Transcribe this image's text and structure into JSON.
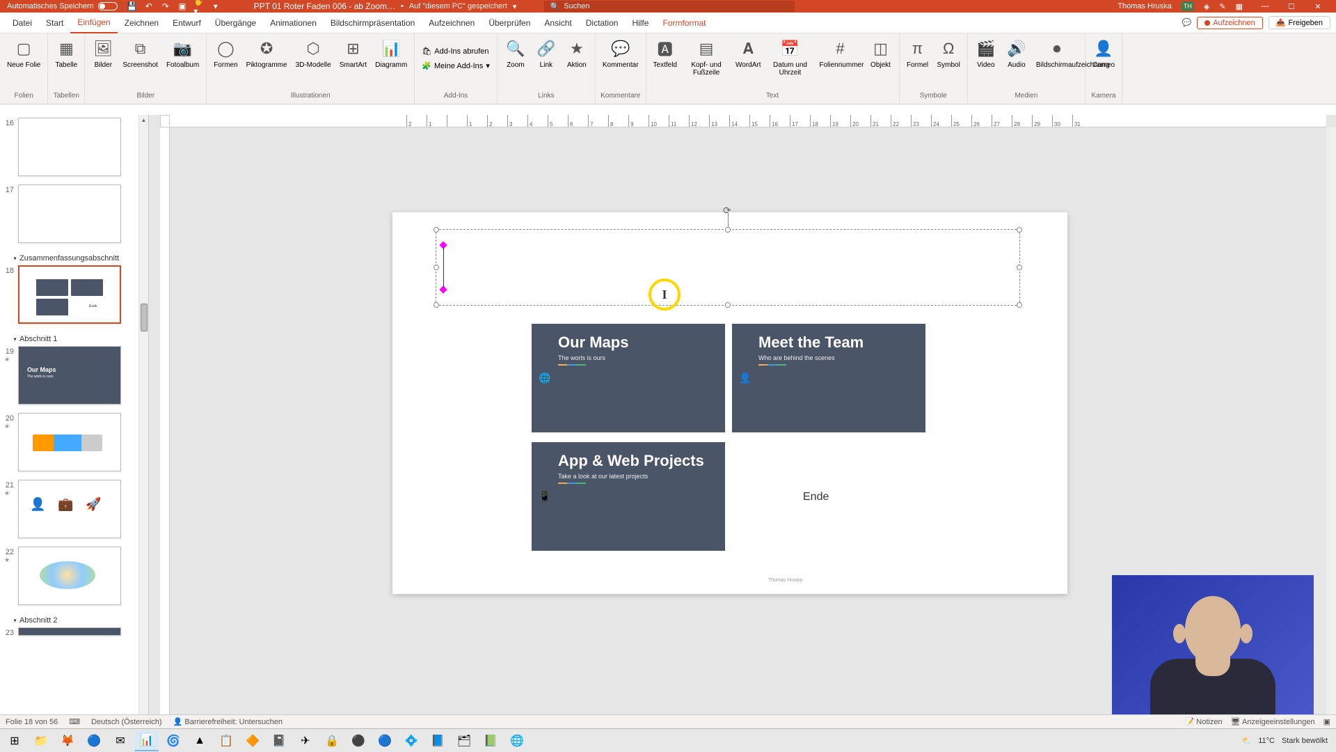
{
  "titlebar": {
    "autosave": "Automatisches Speichern",
    "filename": "PPT 01 Roter Faden 006 - ab Zoom…",
    "savedLoc": "Auf \"diesem PC\" gespeichert",
    "searchPlaceholder": "Suchen",
    "username": "Thomas Hruska",
    "initials": "TH"
  },
  "tabs": {
    "datei": "Datei",
    "start": "Start",
    "einfuegen": "Einfügen",
    "zeichnen": "Zeichnen",
    "entwurf": "Entwurf",
    "uebergaenge": "Übergänge",
    "animationen": "Animationen",
    "praesentation": "Bildschirmpräsentation",
    "aufzeichnen": "Aufzeichnen",
    "ueberpruefen": "Überprüfen",
    "ansicht": "Ansicht",
    "dictation": "Dictation",
    "hilfe": "Hilfe",
    "formformat": "Formformat",
    "aufzeichnenBtn": "Aufzeichnen",
    "freigeben": "Freigeben"
  },
  "ribbon": {
    "neueFolie": "Neue Folie",
    "tabelle": "Tabelle",
    "bilder": "Bilder",
    "screenshot": "Screenshot",
    "fotoalbum": "Fotoalbum",
    "formen": "Formen",
    "piktogramme": "Piktogramme",
    "d3": "3D-Modelle",
    "smartart": "SmartArt",
    "diagramm": "Diagramm",
    "addinsAbrufen": "Add-Ins abrufen",
    "meineAddins": "Meine Add-Ins",
    "zoom": "Zoom",
    "link": "Link",
    "aktion": "Aktion",
    "kommentar": "Kommentar",
    "textfeld": "Textfeld",
    "kopfFuss": "Kopf- und Fußzeile",
    "wordart": "WordArt",
    "datumUhrzeit": "Datum und Uhrzeit",
    "foliennummer": "Foliennummer",
    "objekt": "Objekt",
    "formel": "Formel",
    "symbol": "Symbol",
    "video": "Video",
    "audio": "Audio",
    "bildschirmaufz": "Bildschirmaufzeichnung",
    "cameo": "Cameo",
    "grpFolien": "Folien",
    "grpTabellen": "Tabellen",
    "grpBilder": "Bilder",
    "grpIllustrationen": "Illustrationen",
    "grpAddins": "Add-Ins",
    "grpLinks": "Links",
    "grpKommentare": "Kommentare",
    "grpText": "Text",
    "grpSymbole": "Symbole",
    "grpMedien": "Medien",
    "grpKamera": "Kamera"
  },
  "thumbnails": {
    "n16": "16",
    "n17": "17",
    "n18": "18",
    "n19": "19",
    "n20": "20",
    "n21": "21",
    "n22": "22",
    "n23": "23",
    "secSummary": "Zusammenfassungsabschnitt",
    "sec1": "Abschnitt 1",
    "sec2": "Abschnitt 2",
    "miniMaps": "Our Maps",
    "miniMapsSub": "The worls is ours",
    "miniTeam": "Meet the Team",
    "miniApps": "App & Web",
    "miniEnde": "Ende"
  },
  "slide": {
    "mapsTitle": "Our Maps",
    "mapsSub": "The worls is ours",
    "teamTitle": "Meet the Team",
    "teamSub": "Who are behind the scenes",
    "appsTitle": "App & Web Projects",
    "appsSub": "Take a look at our latest projects",
    "ende": "Ende",
    "sig": "Thomas Hruska"
  },
  "status": {
    "slideOf": "Folie 18 von 56",
    "lang": "Deutsch (Österreich)",
    "access": "Barrierefreiheit: Untersuchen",
    "notizen": "Notizen",
    "anzeige": "Anzeigeeinstellungen"
  },
  "taskbar": {
    "temp": "11°C",
    "weather": "Stark bewölkt"
  },
  "ruler": {
    "ticks": [
      2,
      1,
      "",
      1,
      2,
      3,
      4,
      5,
      6,
      7,
      8,
      9,
      10,
      11,
      12,
      13,
      14,
      15,
      16,
      17,
      18,
      19,
      20,
      21,
      22,
      23,
      24,
      25,
      26,
      27,
      28,
      29,
      30,
      31
    ]
  }
}
